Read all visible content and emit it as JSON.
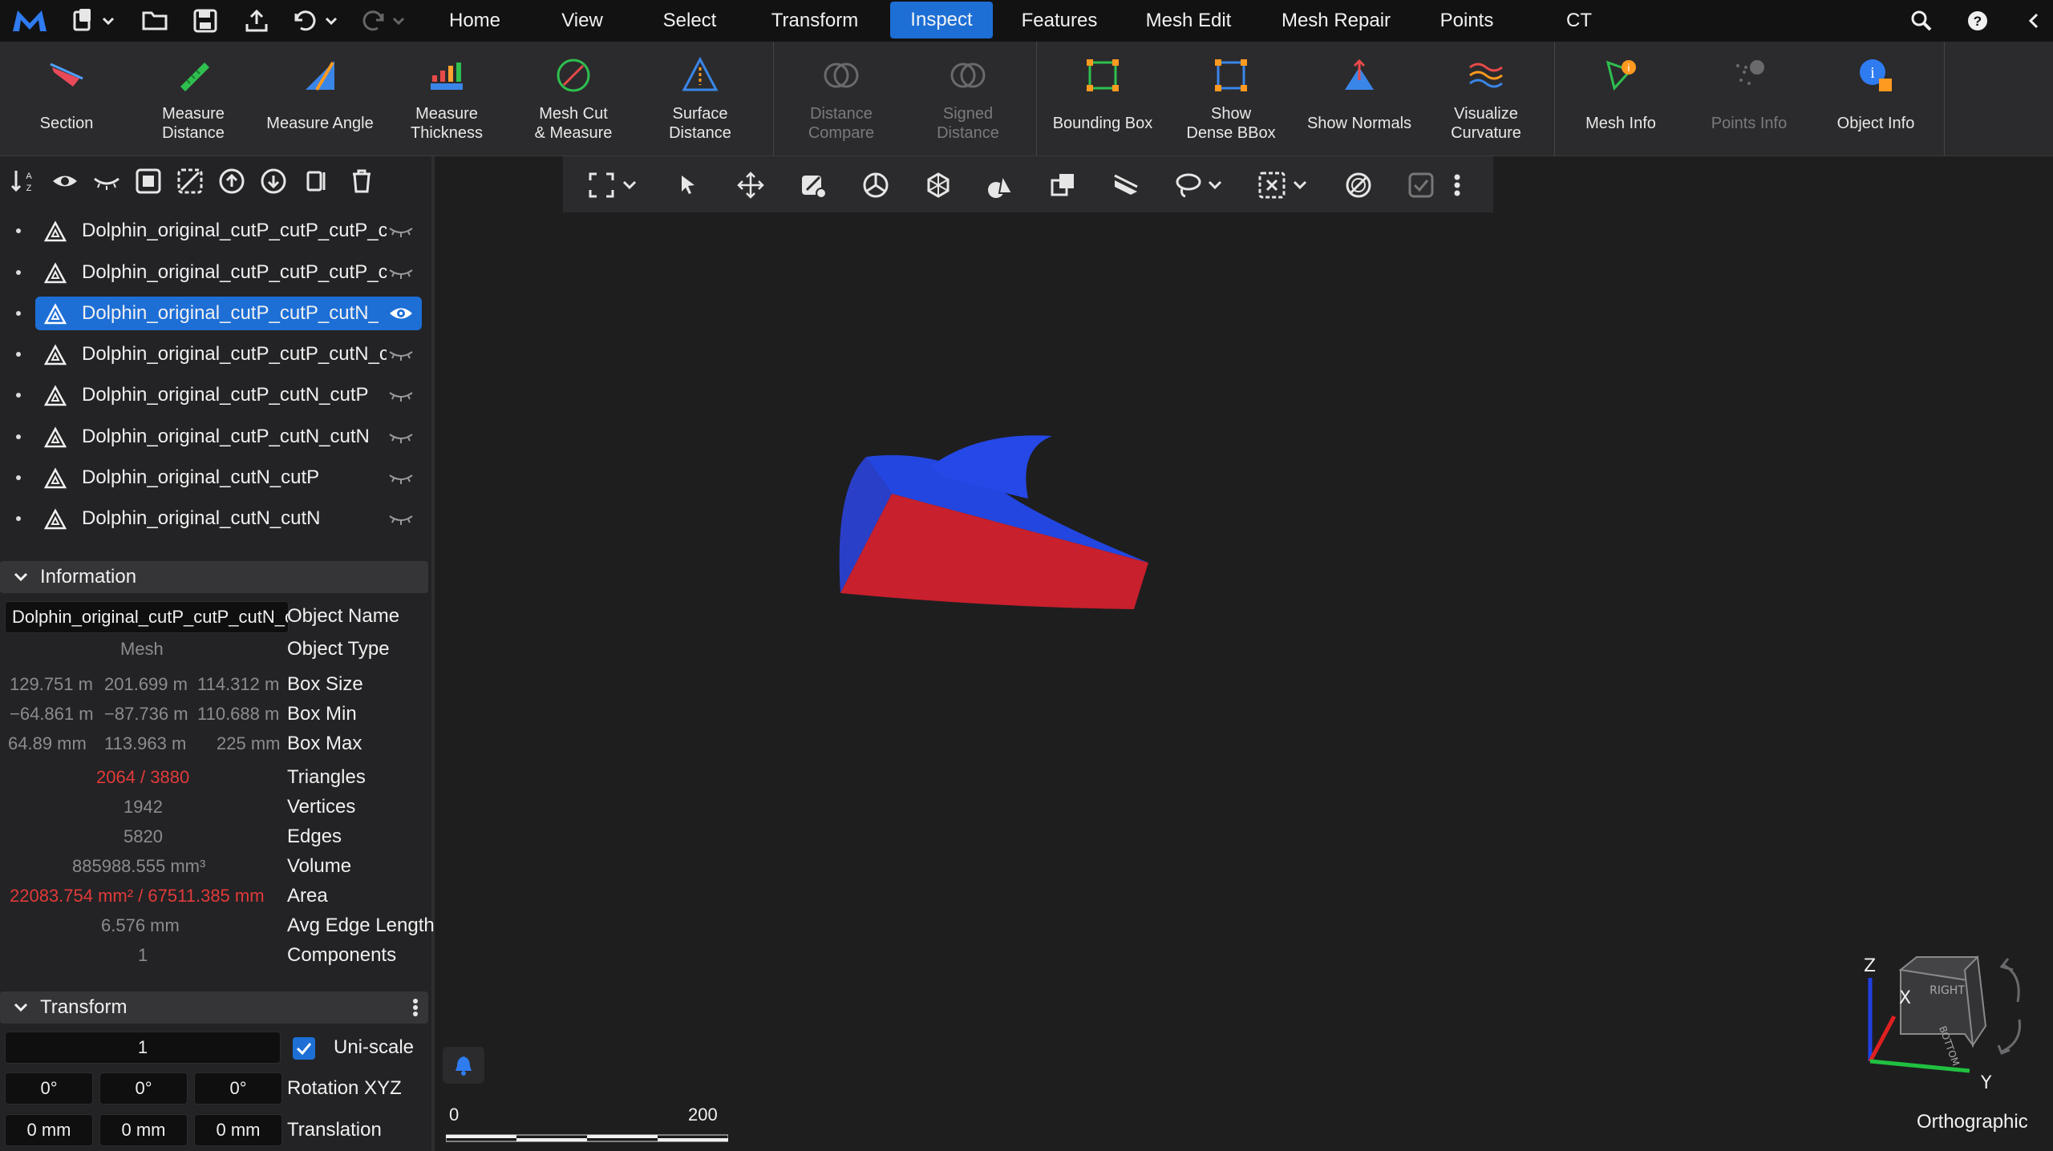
{
  "menu": {
    "tabs": [
      {
        "label": "Home"
      },
      {
        "label": "View"
      },
      {
        "label": "Select"
      },
      {
        "label": "Transform"
      },
      {
        "label": "Inspect"
      },
      {
        "label": "Features"
      },
      {
        "label": "Mesh Edit"
      },
      {
        "label": "Mesh Repair"
      },
      {
        "label": "Points"
      },
      {
        "label": "CT"
      }
    ],
    "active_tab": "Inspect",
    "left_icons": [
      "logo-icon",
      "scene-menu-icon",
      "open-folder-icon",
      "save-icon",
      "export-icon",
      "undo-icon",
      "redo-icon"
    ],
    "right_icons": [
      "search-icon",
      "help-icon",
      "collapse-icon"
    ]
  },
  "ribbon": {
    "tools": [
      {
        "label": "Section",
        "icon": "section-icon",
        "enabled": true
      },
      {
        "label": "Measure\nDistance",
        "icon": "measure-distance-icon",
        "enabled": true
      },
      {
        "label": "Measure Angle",
        "icon": "measure-angle-icon",
        "enabled": true
      },
      {
        "label": "Measure\nThickness",
        "icon": "measure-thickness-icon",
        "enabled": true
      },
      {
        "label": "Mesh Cut\n& Measure",
        "icon": "mesh-cut-icon",
        "enabled": true
      },
      {
        "label": "Surface\nDistance",
        "icon": "surface-distance-icon",
        "enabled": true
      },
      {
        "label": "Distance\nCompare",
        "icon": "distance-compare-icon",
        "enabled": false
      },
      {
        "label": "Signed\nDistance",
        "icon": "signed-distance-icon",
        "enabled": false
      },
      {
        "label": "Bounding Box",
        "icon": "bounding-box-icon",
        "enabled": true
      },
      {
        "label": "Show\nDense BBox",
        "icon": "dense-bbox-icon",
        "enabled": true
      },
      {
        "label": "Show Normals",
        "icon": "show-normals-icon",
        "enabled": true
      },
      {
        "label": "Visualize\nCurvature",
        "icon": "curvature-icon",
        "enabled": true
      },
      {
        "label": "Mesh Info",
        "icon": "mesh-info-icon",
        "enabled": true
      },
      {
        "label": "Points Info",
        "icon": "points-info-icon",
        "enabled": false
      },
      {
        "label": "Object Info",
        "icon": "object-info-icon",
        "enabled": true
      }
    ]
  },
  "scene": {
    "objects": [
      {
        "name": "Dolphin_original_cutP_cutP_cutP_cutP",
        "selected": false,
        "visible": false
      },
      {
        "name": "Dolphin_original_cutP_cutP_cutP_cutN",
        "selected": false,
        "visible": false
      },
      {
        "name": "Dolphin_original_cutP_cutP_cutN_cutP",
        "selected": true,
        "visible": true
      },
      {
        "name": "Dolphin_original_cutP_cutP_cutN_cutN",
        "selected": false,
        "visible": false
      },
      {
        "name": "Dolphin_original_cutP_cutN_cutP",
        "selected": false,
        "visible": false
      },
      {
        "name": "Dolphin_original_cutP_cutN_cutN",
        "selected": false,
        "visible": false
      },
      {
        "name": "Dolphin_original_cutN_cutP",
        "selected": false,
        "visible": false
      },
      {
        "name": "Dolphin_original_cutN_cutN",
        "selected": false,
        "visible": false
      }
    ]
  },
  "information": {
    "title": "Information",
    "object_name_value": "Dolphin_original_cutP_cutP_cutN_cutP",
    "object_name_label": "Object Name",
    "object_type_value": "Mesh",
    "object_type_label": "Object Type",
    "box_size": [
      "129.751 m",
      "201.699 m",
      "114.312 m"
    ],
    "box_size_label": "Box Size",
    "box_min": [
      "−64.861 m",
      "−87.736 m",
      "110.688 m"
    ],
    "box_min_label": "Box Min",
    "box_max": [
      "64.89 mm",
      "113.963 m",
      "225 mm"
    ],
    "box_max_label": "Box Max",
    "triangles_value": "2064 / 3880",
    "triangles_label": "Triangles",
    "vertices_value": "1942",
    "vertices_label": "Vertices",
    "edges_value": "5820",
    "edges_label": "Edges",
    "volume_value": "885988.555 mm³",
    "volume_label": "Volume",
    "area_value": "22083.754 mm² / 67511.385 mm",
    "area_label": "Area",
    "avg_edge_value": "6.576 mm",
    "avg_edge_label": "Avg Edge Length",
    "components_value": "1",
    "components_label": "Components"
  },
  "transform": {
    "title": "Transform",
    "scale_value": "1",
    "uniscale_label": "Uni-scale",
    "uniscale_checked": true,
    "rotation": [
      "0°",
      "0°",
      "0°"
    ],
    "rotation_label": "Rotation XYZ",
    "translation": [
      "0 mm",
      "0 mm",
      "0 mm"
    ],
    "translation_label": "Translation"
  },
  "viewport": {
    "scale_start": "0",
    "scale_end": "200",
    "projection": "Orthographic",
    "axis_labels": {
      "z": "Z",
      "x": "X",
      "y": "Y"
    },
    "cube_faces": {
      "right": "RIGHT",
      "bottom": "BOTTOM"
    },
    "colors": {
      "mesh_top": "#2040e0",
      "mesh_side": "#c8202c",
      "accent": "#1d6fd6"
    }
  }
}
